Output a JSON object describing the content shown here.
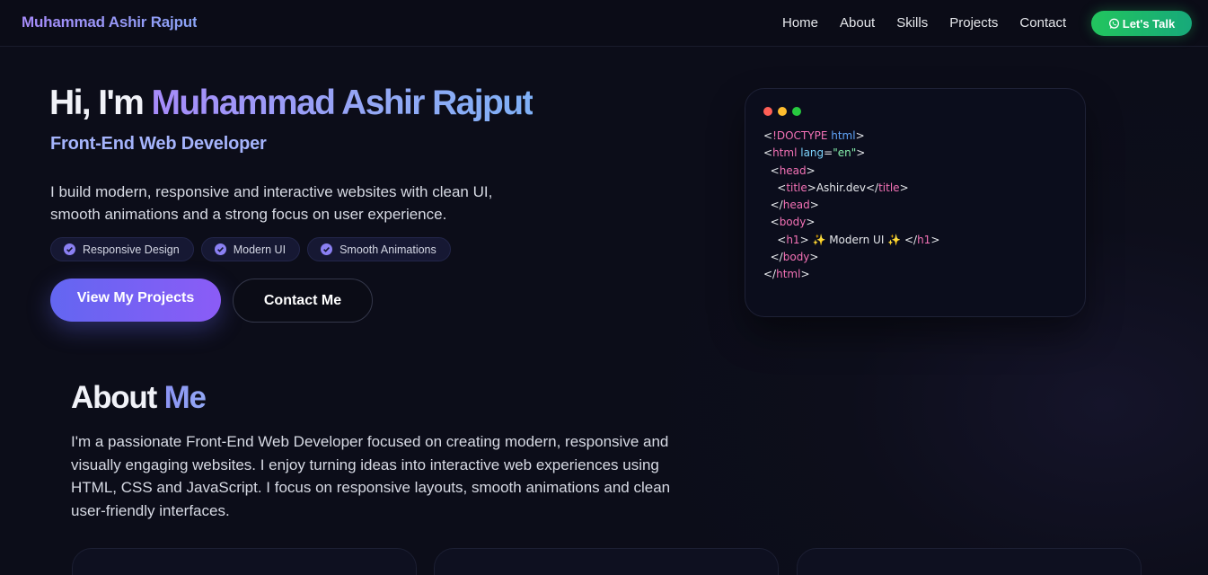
{
  "navbar": {
    "brand": "Muhammad Ashir Rajput",
    "links": [
      "Home",
      "About",
      "Skills",
      "Projects",
      "Contact"
    ],
    "cta_label": "Let's Talk"
  },
  "hero": {
    "title_prefix": "Hi, I'm ",
    "title_name": "Muhammad Ashir Rajput",
    "role": "Front-End Web Developer",
    "description": "I build modern, responsive and interactive websites with clean UI, smooth animations and a strong focus on user experience.",
    "pills": [
      "Responsive Design",
      "Modern UI",
      "Smooth Animations"
    ],
    "primary_button": "View My Projects",
    "secondary_button": "Contact Me"
  },
  "code_card": {
    "window_dots": [
      "#ff5f56",
      "#ffbd2e",
      "#27c93f"
    ],
    "lines": [
      "<!DOCTYPE html>",
      "<html lang=\"en\">",
      "  <head>",
      "    <title>Ashir.dev</title>",
      "  </head>",
      "  <body>",
      "    <h1> ✨ Modern UI ✨ </h1>",
      "  </body>",
      "</html>"
    ]
  },
  "about": {
    "title_prefix": "About ",
    "title_highlight": "Me",
    "text": "I'm a passionate Front-End Web Developer focused on creating modern, responsive and visually engaging websites. I enjoy turning ideas into interactive web experiences using HTML, CSS and JavaScript. I focus on responsive layouts, smooth animations and clean user-friendly interfaces."
  },
  "colors": {
    "accent": "#6366f1",
    "accent_purple": "#8b5cf6",
    "cta_green": "#22c55e",
    "background": "#0c0d19"
  },
  "icons": {
    "cta_icon": "whatsapp-icon",
    "pill_icon": "check-circle-icon"
  }
}
